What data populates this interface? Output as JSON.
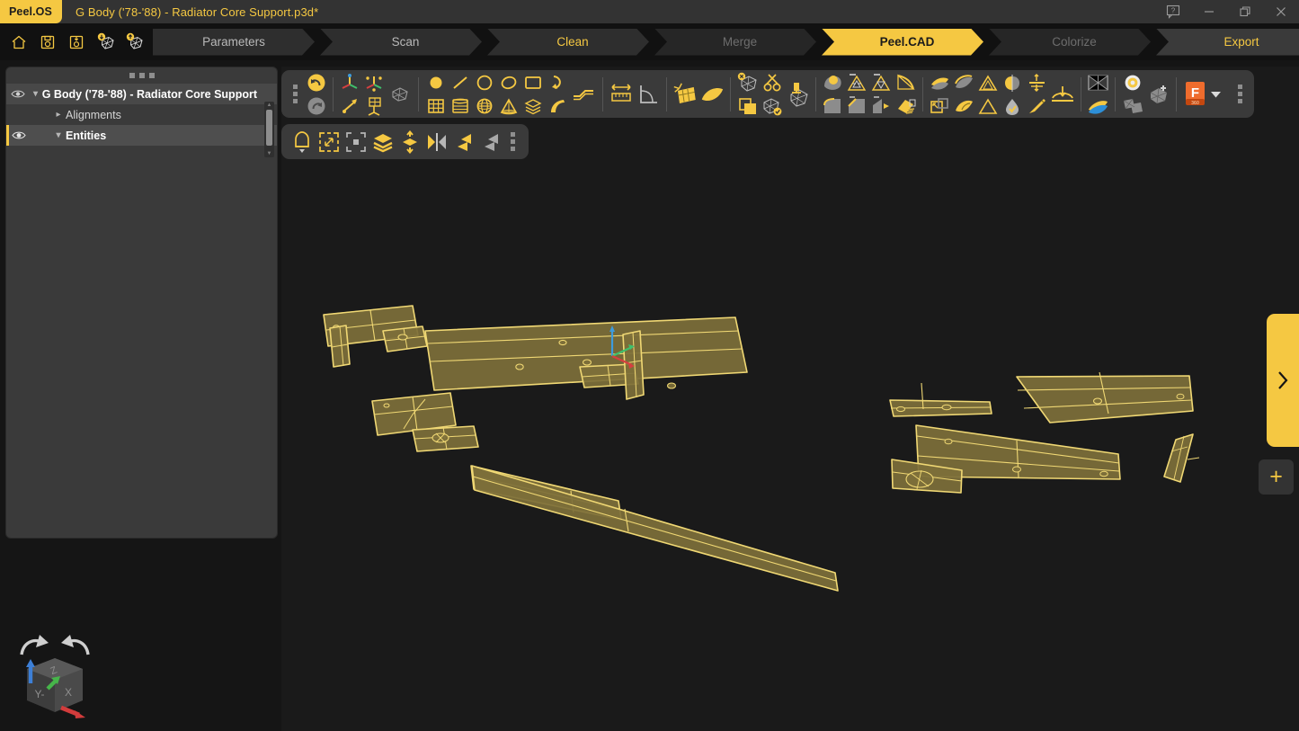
{
  "app": {
    "brand": "Peel.OS",
    "document_title": "G Body ('78-'88) - Radiator Core Support.p3d*",
    "accent_color": "#f5c842",
    "viewport_bg": "#1a1a1a",
    "panel_bg": "#3a3a3a"
  },
  "window_controls": [
    {
      "name": "help-button",
      "icon": "help-bubble-icon",
      "glyph": "?"
    },
    {
      "name": "minimize-button",
      "icon": "minimize-icon",
      "glyph": "—"
    },
    {
      "name": "maximize-button",
      "icon": "restore-icon",
      "glyph": "❐"
    },
    {
      "name": "close-button",
      "icon": "close-icon",
      "glyph": "✕"
    }
  ],
  "quick_actions": [
    {
      "name": "home-button",
      "icon": "home-icon",
      "label": "Home"
    },
    {
      "name": "save-button",
      "icon": "save-disk-icon",
      "label": "Save"
    },
    {
      "name": "save-as-button",
      "icon": "save-as-disk-icon",
      "label": "Save As"
    },
    {
      "name": "import-button",
      "icon": "import-mesh-icon",
      "label": "Import"
    },
    {
      "name": "export-mesh-button",
      "icon": "export-mesh-icon",
      "label": "Export"
    }
  ],
  "workflow": {
    "active": "Peel.CAD",
    "steps": [
      {
        "label": "Parameters",
        "state": "idle"
      },
      {
        "label": "Scan",
        "state": "idle"
      },
      {
        "label": "Clean",
        "state": "done"
      },
      {
        "label": "Merge",
        "state": "muted"
      },
      {
        "label": "Peel.CAD",
        "state": "active"
      },
      {
        "label": "Colorize",
        "state": "muted"
      },
      {
        "label": "Export",
        "state": "export"
      }
    ]
  },
  "sidebar": {
    "grip": "panel-drag-handle",
    "tree": [
      {
        "label": "G Body ('78-'88) - Radiator Core Support",
        "level": 0,
        "eye": true,
        "chevron": "down",
        "selected": false,
        "root": true
      },
      {
        "label": "Alignments",
        "level": 1,
        "eye": false,
        "chevron": "right",
        "selected": false,
        "root": false
      },
      {
        "label": "Entities",
        "level": 1,
        "eye": true,
        "chevron": "down",
        "selected": true,
        "root": false
      }
    ]
  },
  "main_toolbar": {
    "groups": [
      {
        "name": "history",
        "tools": [
          {
            "name": "undo-button",
            "icon": "undo-arrow-icon",
            "enabled": true
          },
          {
            "name": "redo-button",
            "icon": "redo-arrow-icon",
            "enabled": false
          }
        ]
      },
      {
        "name": "alignment",
        "tools": [
          {
            "name": "align-axis-button",
            "icon": "axis-align-icon"
          },
          {
            "name": "align-arrow-button",
            "icon": "diagonal-arrow-icon"
          },
          {
            "name": "align-points-button",
            "icon": "point-align-icon"
          },
          {
            "name": "align-plane-button",
            "icon": "grid-plane-align-icon"
          },
          {
            "name": "align-mesh-button",
            "icon": "mesh-align-icon"
          }
        ]
      },
      {
        "name": "primitives",
        "tools": [
          {
            "name": "point-button",
            "icon": "point-icon"
          },
          {
            "name": "line-button",
            "icon": "line-icon"
          },
          {
            "name": "circle-button",
            "icon": "circle-icon"
          },
          {
            "name": "ellipse-button",
            "icon": "ellipse-icon"
          },
          {
            "name": "rectangle-button",
            "icon": "rectangle-icon"
          },
          {
            "name": "arc-button",
            "icon": "arc-icon"
          },
          {
            "name": "polyline-button",
            "icon": "polyline-icon"
          },
          {
            "name": "grid-button",
            "icon": "grid-icon"
          },
          {
            "name": "cylinder-button",
            "icon": "cylinder-icon"
          },
          {
            "name": "sphere-button",
            "icon": "sphere-icon"
          },
          {
            "name": "cone-button",
            "icon": "cone-icon"
          },
          {
            "name": "layers-button",
            "icon": "stacked-layers-icon"
          },
          {
            "name": "sweep-button",
            "icon": "sweep-curve-icon"
          }
        ]
      },
      {
        "name": "measure",
        "tools": [
          {
            "name": "measure-distance-button",
            "icon": "ruler-icon"
          },
          {
            "name": "measure-angle-button",
            "icon": "angle-icon"
          }
        ]
      },
      {
        "name": "surface-fit",
        "tools": [
          {
            "name": "fit-patch-button",
            "icon": "patch-fit-icon"
          },
          {
            "name": "fit-surface-button",
            "icon": "curved-surface-icon"
          }
        ]
      },
      {
        "name": "mesh-edit",
        "tools": [
          {
            "name": "delete-mesh-button",
            "icon": "mesh-delete-icon"
          },
          {
            "name": "cut-mesh-button",
            "icon": "scissors-icon"
          },
          {
            "name": "duplicate-button",
            "icon": "copy-squares-icon"
          },
          {
            "name": "accept-mesh-button",
            "icon": "mesh-check-icon"
          },
          {
            "name": "extract-mesh-button",
            "icon": "mesh-extract-icon"
          }
        ]
      },
      {
        "name": "region-tools",
        "tools": [
          {
            "name": "region-select-button",
            "icon": "region-blob-icon"
          },
          {
            "name": "triangle-reduce-button",
            "icon": "triangle-reduce-icon"
          },
          {
            "name": "triangle-refine-button",
            "icon": "triangle-refine-icon"
          },
          {
            "name": "fillet-button",
            "icon": "fillet-arc-icon"
          },
          {
            "name": "chamfer-button",
            "icon": "chamfer-icon"
          },
          {
            "name": "draft-button",
            "icon": "draft-angle-icon"
          },
          {
            "name": "taper-button",
            "icon": "taper-icon"
          },
          {
            "name": "brush-button",
            "icon": "paint-brush-icon"
          }
        ]
      },
      {
        "name": "solid-tools",
        "tools": [
          {
            "name": "thicken-button",
            "icon": "thicken-icon"
          },
          {
            "name": "offset-button",
            "icon": "offset-surface-icon"
          },
          {
            "name": "shell-button",
            "icon": "shell-triangle-icon"
          },
          {
            "name": "mirror-half-button",
            "icon": "mirror-half-icon"
          },
          {
            "name": "distance-constraint-button",
            "icon": "distance-constraint-icon"
          },
          {
            "name": "project-down-button",
            "icon": "project-down-icon"
          },
          {
            "name": "boolean-button",
            "icon": "boolean-squares-icon"
          },
          {
            "name": "bend-button",
            "icon": "bend-surface-icon"
          },
          {
            "name": "triangle-ok-button",
            "icon": "triangle-check-icon"
          },
          {
            "name": "fill-hole-button",
            "icon": "droplet-fill-icon"
          },
          {
            "name": "smooth-button",
            "icon": "smooth-stick-icon"
          }
        ]
      },
      {
        "name": "display",
        "tools": [
          {
            "name": "wireframe-toggle-button",
            "icon": "wireframe-icon"
          },
          {
            "name": "shaded-toggle-button",
            "icon": "shaded-surface-icon"
          }
        ]
      },
      {
        "name": "targets",
        "tools": [
          {
            "name": "target-button",
            "icon": "target-ring-icon"
          },
          {
            "name": "add-scan-button",
            "icon": "add-scan-icon"
          },
          {
            "name": "merge-scan-button",
            "icon": "merge-scan-icon"
          }
        ]
      },
      {
        "name": "export-cad",
        "tools": [
          {
            "name": "fusion360-export-button",
            "icon": "fusion-360-icon",
            "label": "F",
            "sub_label": "360"
          },
          {
            "name": "fusion360-dropdown",
            "icon": "chevron-down-icon"
          }
        ]
      },
      {
        "name": "overflow",
        "tools": [
          {
            "name": "toolbar-overflow-button",
            "icon": "more-vertical-icon"
          }
        ]
      }
    ]
  },
  "selection_toolbar": {
    "tools": [
      {
        "name": "lasso-select-button",
        "icon": "lasso-icon",
        "has_dropdown": true
      },
      {
        "name": "expand-selection-button",
        "icon": "expand-selection-icon"
      },
      {
        "name": "shrink-selection-button",
        "icon": "shrink-selection-icon"
      },
      {
        "name": "select-layers-button",
        "icon": "stacked-layers-icon"
      },
      {
        "name": "select-through-button",
        "icon": "select-through-icon"
      },
      {
        "name": "mirror-selection-button",
        "icon": "mirror-selection-icon"
      },
      {
        "name": "flip-left-button",
        "icon": "flip-left-icon"
      },
      {
        "name": "flip-right-button",
        "icon": "flip-right-icon"
      },
      {
        "name": "selection-overflow-button",
        "icon": "more-vertical-icon"
      }
    ]
  },
  "viewport": {
    "name": "3d-viewport",
    "gizmo": {
      "name": "axis-gizmo",
      "axes": [
        {
          "label": "Z",
          "color": "#3d9bdd"
        },
        {
          "label": "Y",
          "color": "#3fc06c"
        },
        {
          "label": "X",
          "color": "#d64040"
        }
      ]
    },
    "geometry_color": "#f0d874",
    "geometry_fill": "#7d6f3a",
    "entity_count_visible": 13
  },
  "view_cube": {
    "name": "view-cube",
    "faces": [
      {
        "label": "Z",
        "position": "top"
      },
      {
        "label": "Y-",
        "position": "left"
      },
      {
        "label": "X",
        "position": "right"
      }
    ],
    "rotate_left": "rotate-ccw-icon",
    "rotate_right": "rotate-cw-icon"
  },
  "right_panel": {
    "expand_tab": {
      "name": "expand-right-panel-button",
      "icon": "chevron-right-icon"
    },
    "add_button": {
      "name": "add-entity-button",
      "icon": "plus-icon",
      "glyph": "+"
    }
  }
}
